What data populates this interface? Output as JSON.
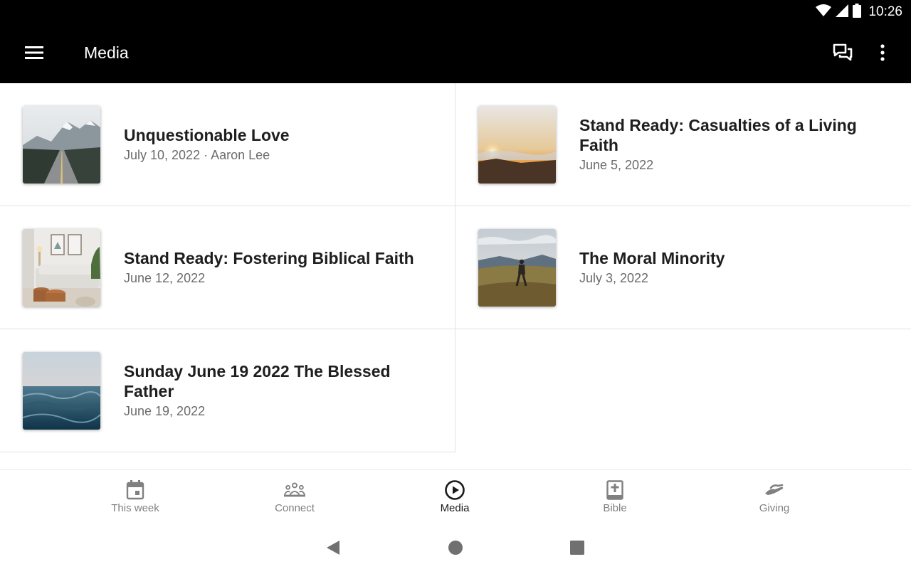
{
  "status_bar": {
    "time": "10:26",
    "icons": [
      "wifi-icon",
      "signal-icon",
      "battery-icon"
    ]
  },
  "app_bar": {
    "title": "Media",
    "icons": {
      "menu": "menu-icon",
      "chat": "chat-icon",
      "more": "more-vert-icon"
    }
  },
  "media_items": [
    {
      "title": "Unquestionable Love",
      "subtitle": "July 10, 2022 · Aaron Lee",
      "thumbnail": "mountain-road"
    },
    {
      "title": "Stand Ready: Casualties of a Living Faith",
      "subtitle": "June 5, 2022",
      "thumbnail": "sunrise-clouds"
    },
    {
      "title": "Stand Ready: Fostering Biblical Faith",
      "subtitle": "June 12, 2022",
      "thumbnail": "living-room"
    },
    {
      "title": "The Moral Minority",
      "subtitle": "July 3, 2022",
      "thumbnail": "hiker-field"
    },
    {
      "title": "Sunday June 19 2022 The Blessed Father",
      "subtitle": "June 19, 2022",
      "thumbnail": "ocean-waves"
    }
  ],
  "bottom_nav": {
    "items": [
      {
        "label": "This week",
        "icon": "calendar-icon",
        "active": false
      },
      {
        "label": "Connect",
        "icon": "people-icon",
        "active": false
      },
      {
        "label": "Media",
        "icon": "play-circle-icon",
        "active": true
      },
      {
        "label": "Bible",
        "icon": "bible-icon",
        "active": false
      },
      {
        "label": "Giving",
        "icon": "giving-hand-icon",
        "active": false
      }
    ]
  },
  "system_nav": {
    "icons": [
      "back-icon",
      "home-icon",
      "recents-icon"
    ]
  },
  "colors": {
    "app_bar": "#000000",
    "divider": "#e2e2e2",
    "title_text": "#1e1e1e",
    "subtitle_text": "#6b6b6b",
    "nav_inactive": "#808080",
    "nav_active": "#1a1a1a"
  }
}
